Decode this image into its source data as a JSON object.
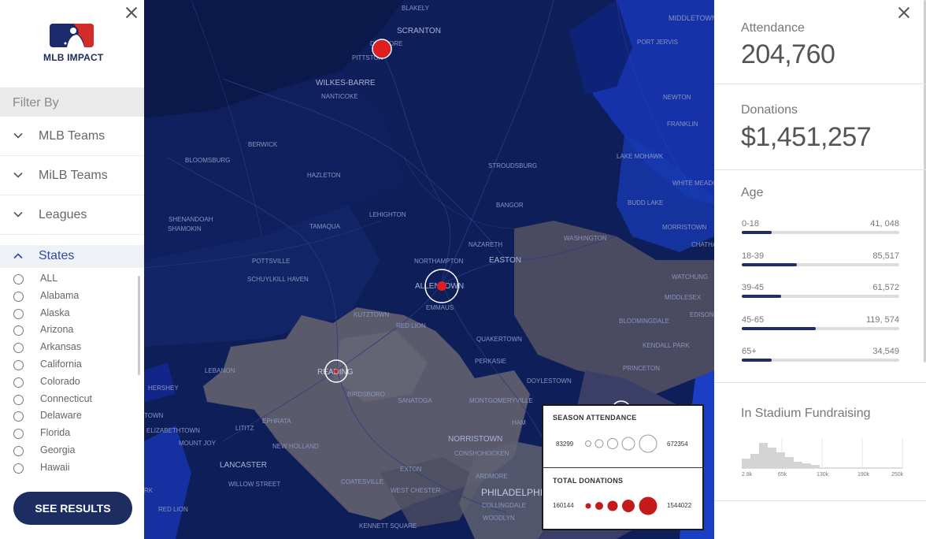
{
  "sidebar": {
    "brand": "MLB IMPACT",
    "filter_title": "Filter By",
    "accordions": [
      {
        "label": "MLB Teams"
      },
      {
        "label": "MiLB Teams"
      },
      {
        "label": "Leagues"
      },
      {
        "label": "States"
      }
    ],
    "states": [
      "ALL",
      "Alabama",
      "Alaska",
      "Arizona",
      "Arkansas",
      "California",
      "Colorado",
      "Connecticut",
      "Delaware",
      "Florida",
      "Georgia",
      "Hawaii"
    ],
    "see_results": "SEE RESULTS"
  },
  "map": {
    "places": [
      "BLAKELY",
      "SCRANTON",
      "DUNMORE",
      "PITTSTON",
      "WILKES-BARRE",
      "NANTICOKE",
      "MIDDLETOWN",
      "PORT JERVIS",
      "BERWICK",
      "BLOOMSBURG",
      "HAZLETON",
      "LEHIGHTON",
      "SHENANDOAH",
      "TAMAQUA",
      "SHAMOKIN",
      "POTTSVILLE",
      "SCHUYLKILL HAVEN",
      "BANGOR",
      "STROUDSBURG",
      "NAZARETH",
      "EASTON",
      "NORTHAMPTON",
      "ALLENTOWN",
      "EMMAUS",
      "KUTZTOWN",
      "RED LION",
      "QUAKERTOWN",
      "PERKASIE",
      "DOYLESTOWN",
      "LEBANON",
      "HERSHEY",
      "READING",
      "BIRDSBORO",
      "SANATOGA",
      "EPHRATA",
      "LITITZ",
      "ELIZABETHTOWN",
      "MOUNT JOY",
      "NEW HOLLAND",
      "LANCASTER",
      "WILLOW STREET",
      "COATESVILLE",
      "EXTON",
      "WEST CHESTER",
      "NORRISTOWN",
      "CONSHOHOCKEN",
      "ARDMORE",
      "PHILADELPHIA",
      "COLLINGDALE",
      "WOODLYN",
      "KENNETT SQUARE",
      "MONTGOMERYVILLE",
      "WASHINGTON",
      "MORRISTOWN",
      "BLOOMINGDALE",
      "KENDALL PARK",
      "PRINCETON",
      "MIDDLESEX",
      "EDISON",
      "WATCHUNG",
      "BUDD LAKE",
      "WHITE MEADOW LAKE",
      "LAKE MOHAWK",
      "NEWTON",
      "FRANKLIN",
      "TOWN",
      "RED LION",
      "CHATHAM",
      "RK",
      "HAM"
    ],
    "legend": {
      "attendance_title": "SEASON ATTENDANCE",
      "attendance_min": "83299",
      "attendance_max": "672354",
      "donations_title": "TOTAL DONATIONS",
      "donations_min": "160144",
      "donations_max": "1544022"
    }
  },
  "panel": {
    "attendance_label": "Attendance",
    "attendance_value": "204,760",
    "donations_label": "Donations",
    "donations_value": "$1,451,257",
    "age_label": "Age",
    "age_groups": [
      {
        "label": "0-18",
        "value": "41, 048",
        "fraction": 0.19
      },
      {
        "label": "18-39",
        "value": "85,517",
        "fraction": 0.35
      },
      {
        "label": "39-45",
        "value": "61,572",
        "fraction": 0.25
      },
      {
        "label": "45-65",
        "value": "119, 574",
        "fraction": 0.47
      },
      {
        "label": "65+",
        "value": "34,549",
        "fraction": 0.19
      }
    ],
    "fundraising_label": "In Stadium Fundraising",
    "histogram_ticks": [
      "2.8k",
      "65k",
      "130k",
      "190k",
      "250k"
    ]
  },
  "colors": {
    "navy": "#1d2d62",
    "map_dark": "#0b1a52",
    "map_bright": "#1639b8",
    "map_gray": "#5a5a6c",
    "marker_red": "#d81e1e",
    "states_accent": "#2c4aa0"
  }
}
